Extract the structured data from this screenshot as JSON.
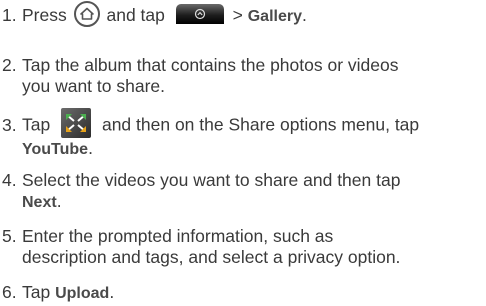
{
  "steps": [
    {
      "num": "1.",
      "part1": "Press",
      "part2": "and tap",
      "part3": ">",
      "bold": "Gallery",
      "end": "."
    },
    {
      "num": "2.",
      "line1": "Tap the album that contains the photos or videos",
      "line2": "you want to share."
    },
    {
      "num": "3.",
      "part1": "Tap",
      "part2": "and then on the Share options menu, tap",
      "bold": "YouTube",
      "end": "."
    },
    {
      "num": "4.",
      "line1": "Select the videos you want to share and then tap",
      "bold": "Next",
      "end": "."
    },
    {
      "num": "5.",
      "line1": "Enter the prompted information, such as",
      "line2": "description and tags, and select a privacy option."
    },
    {
      "num": "6.",
      "part1": "Tap",
      "bold": "Upload",
      "end": "."
    }
  ],
  "icons": {
    "home": "home-icon",
    "launcher": "launcher-tab-icon",
    "share": "share-icon"
  }
}
